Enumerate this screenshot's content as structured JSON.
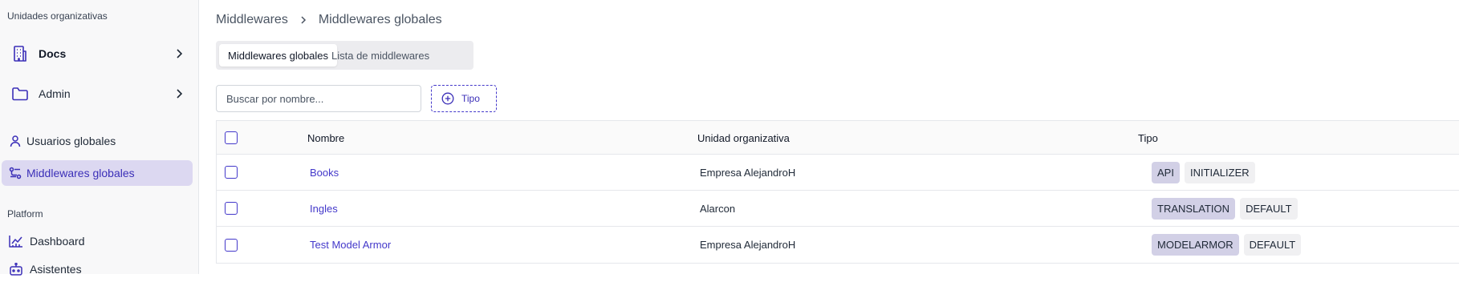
{
  "sidebar": {
    "org_section_label": "Unidades organizativas",
    "orgs": [
      {
        "label": "Docs",
        "icon": "building-icon"
      },
      {
        "label": "Admin",
        "icon": "folder-icon"
      }
    ],
    "global_items": [
      {
        "label": "Usuarios globales",
        "icon": "user-icon"
      },
      {
        "label": "Middlewares globales",
        "icon": "middleware-icon"
      }
    ],
    "platform_section_label": "Platform",
    "platform_items": [
      {
        "label": "Dashboard",
        "icon": "chart-icon"
      },
      {
        "label": "Asistentes",
        "icon": "bot-icon"
      }
    ]
  },
  "breadcrumb": {
    "items": [
      "Middlewares",
      "Middlewares globales"
    ]
  },
  "tabs": [
    {
      "label": "Middlewares globales",
      "active": true
    },
    {
      "label": "Lista de middlewares",
      "active": false
    }
  ],
  "filters": {
    "search_placeholder": "Buscar por nombre...",
    "search_value": "",
    "type_button_label": "Tipo"
  },
  "table": {
    "columns": [
      "Nombre",
      "Unidad organizativa",
      "Tipo"
    ],
    "rows": [
      {
        "name": "Books",
        "org": "Empresa AlejandroH",
        "types": [
          "API",
          "INITIALIZER"
        ]
      },
      {
        "name": "Ingles",
        "org": "Alarcon",
        "types": [
          "TRANSLATION",
          "DEFAULT"
        ]
      },
      {
        "name": "Test Model Armor",
        "org": "Empresa AlejandroH",
        "types": [
          "MODELARMOR",
          "DEFAULT"
        ]
      }
    ]
  },
  "colors": {
    "accent": "#4338ca",
    "active_nav_bg": "#dcd8f1",
    "primary_badge_bg": "#d2d0e6",
    "secondary_badge_bg": "#f0f0f2"
  }
}
